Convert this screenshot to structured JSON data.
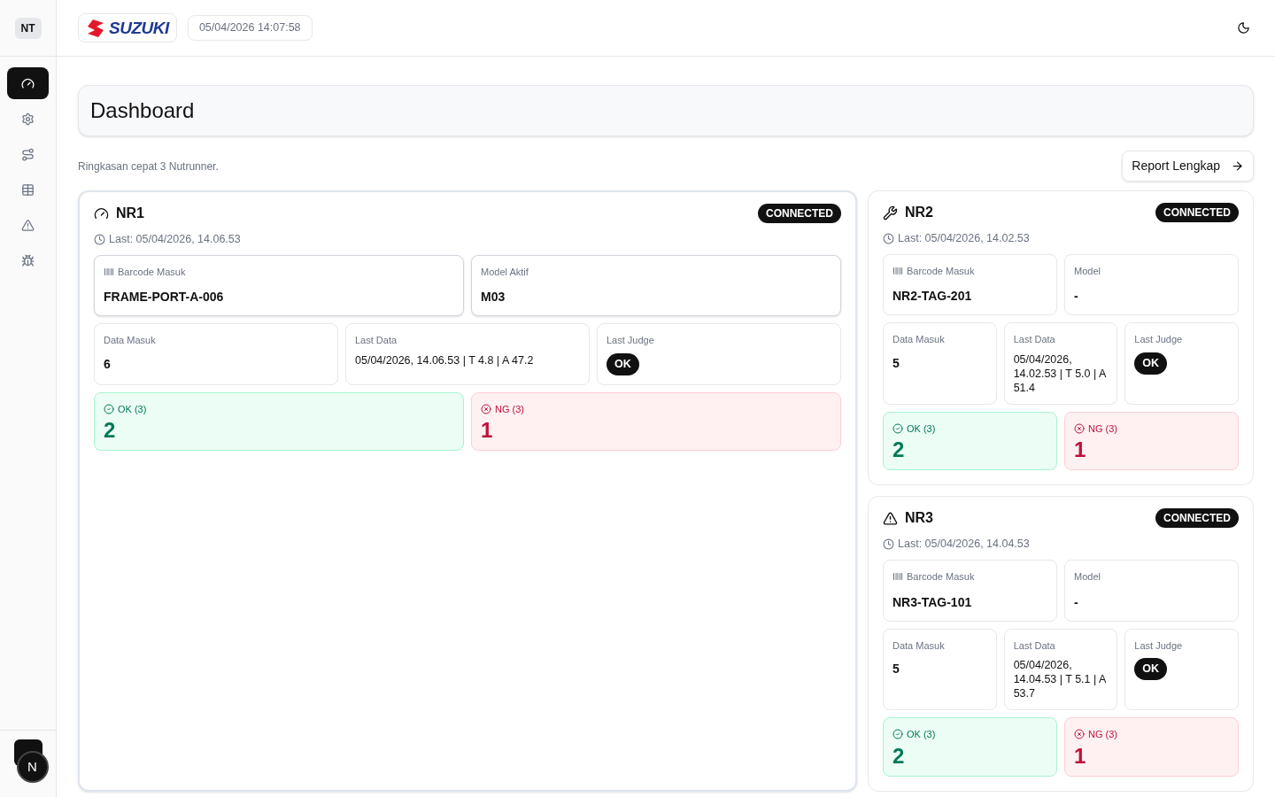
{
  "sidebar": {
    "avatar": "NT",
    "items": [
      {
        "selected": true
      },
      {
        "selected": false
      },
      {
        "selected": false
      },
      {
        "selected": false
      },
      {
        "selected": false
      },
      {
        "selected": false
      }
    ],
    "dev_badge": "N"
  },
  "header": {
    "logo": "SUZUKI",
    "datetime": "05/04/2026 14:07:58"
  },
  "page": {
    "title": "Dashboard",
    "subtitle": "Ringkasan cepat 3 Nutrunner.",
    "report_button": "Report Lengkap"
  },
  "nutrunners": [
    {
      "name": "NR1",
      "selected": true,
      "status": "CONNECTED",
      "last": "Last: 05/04/2026, 14.06.53",
      "barcode_label": "Barcode Masuk",
      "barcode": "FRAME-PORT-A-006",
      "model_label": "Model Aktif",
      "model": "M03",
      "data_label": "Data Masuk",
      "data": "6",
      "last_data_label": "Last Data",
      "last_data": "05/04/2026, 14.06.53 | T 4.8 | A 47.2",
      "judge_label": "Last Judge",
      "judge": "OK",
      "ok_label": "OK (3)",
      "ok": "2",
      "ng_label": "NG (3)",
      "ng": "1"
    },
    {
      "name": "NR2",
      "selected": false,
      "status": "CONNECTED",
      "last": "Last: 05/04/2026, 14.02.53",
      "barcode_label": "Barcode Masuk",
      "barcode": "NR2-TAG-201",
      "model_label": "Model",
      "model": "-",
      "data_label": "Data Masuk",
      "data": "5",
      "last_data_label": "Last Data",
      "last_data": "05/04/2026, 14.02.53 | T 5.0 | A 51.4",
      "judge_label": "Last Judge",
      "judge": "OK",
      "ok_label": "OK (3)",
      "ok": "2",
      "ng_label": "NG (3)",
      "ng": "1"
    },
    {
      "name": "NR3",
      "selected": false,
      "status": "CONNECTED",
      "last": "Last: 05/04/2026, 14.04.53",
      "barcode_label": "Barcode Masuk",
      "barcode": "NR3-TAG-101",
      "model_label": "Model",
      "model": "-",
      "data_label": "Data Masuk",
      "data": "5",
      "last_data_label": "Last Data",
      "last_data": "05/04/2026, 14.04.53 | T 5.1 | A 53.7",
      "judge_label": "Last Judge",
      "judge": "OK",
      "ok_label": "OK (3)",
      "ok": "2",
      "ng_label": "NG (3)",
      "ng": "1"
    }
  ]
}
